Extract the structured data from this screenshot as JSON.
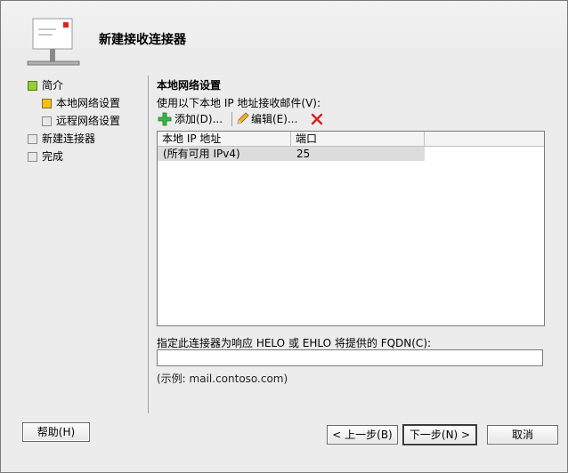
{
  "window": {
    "title": "新建接收连接器"
  },
  "nav": {
    "items": [
      {
        "label": "简介",
        "status": "done"
      },
      {
        "label": "本地网络设置",
        "status": "current"
      },
      {
        "label": "远程网络设置",
        "status": "pending"
      },
      {
        "label": "新建连接器",
        "status": "pending"
      },
      {
        "label": "完成",
        "status": "pending"
      }
    ]
  },
  "content": {
    "section_title": "本地网络设置",
    "prompt": "使用以下本地 IP 地址接收邮件(V):",
    "toolbar": {
      "add_label": "添加(D)...",
      "edit_label": "编辑(E)...",
      "icons": [
        "add-icon",
        "edit-pencil-icon",
        "delete-icon"
      ]
    },
    "table": {
      "columns": [
        "本地 IP 地址",
        "端口"
      ],
      "rows": [
        {
          "ip": "(所有可用 IPv4)",
          "port": "25"
        }
      ]
    },
    "fqdn": {
      "label": "指定此连接器为响应 HELO 或 EHLO 将提供的 FQDN(C):",
      "value": "",
      "example": "(示例: mail.contoso.com)"
    }
  },
  "buttons": {
    "help": "帮助(H)",
    "back": "< 上一步(B)",
    "next": "下一步(N) >",
    "cancel": "取消"
  },
  "colors": {
    "status_done": "#9acd32",
    "status_current": "#f2c21a",
    "delete_icon": "#d42020",
    "add_icon": "#3cb34a"
  }
}
